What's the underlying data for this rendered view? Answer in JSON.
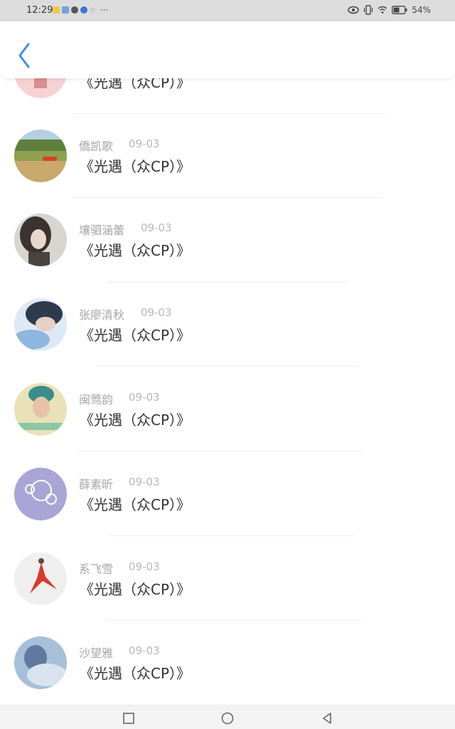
{
  "status_bar": {
    "time": "12:29",
    "more": "···",
    "battery": "54%"
  },
  "header": {
    "back_icon": "chevron-left-icon",
    "accent": "#3d8fe8"
  },
  "items": [
    {
      "name": "",
      "date": "",
      "title": "《光遇（众CP）》"
    },
    {
      "name": "僑凯歌",
      "date": "09-03",
      "title": "《光遇（众CP）》"
    },
    {
      "name": "壤驷涵蕾",
      "date": "09-03",
      "title": "《光遇（众CP）》"
    },
    {
      "name": "张廖清秋",
      "date": "09-03",
      "title": "《光遇（众CP）》"
    },
    {
      "name": "闽莺韵",
      "date": "09-03",
      "title": "《光遇（众CP）》"
    },
    {
      "name": "薛素昕",
      "date": "09-03",
      "title": "《光遇（众CP）》"
    },
    {
      "name": "系飞雪",
      "date": "09-03",
      "title": "《光遇（众CP）》"
    },
    {
      "name": "沙望雅",
      "date": "09-03",
      "title": "《光遇（众CP）》"
    }
  ],
  "nav": {
    "recent_icon": "square-icon",
    "home_icon": "circle-icon",
    "back_icon": "triangle-back-icon"
  }
}
